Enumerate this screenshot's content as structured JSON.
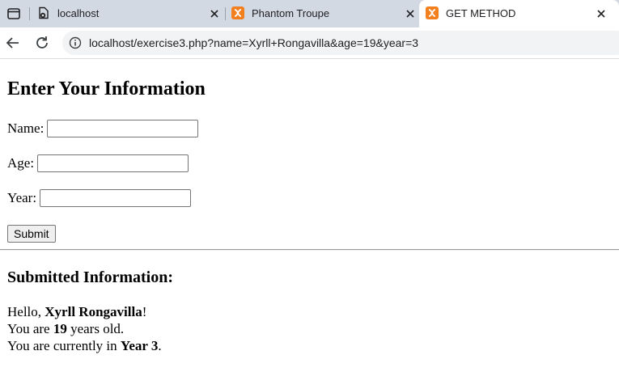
{
  "browser": {
    "tabs": [
      {
        "title": "localhost",
        "active": false
      },
      {
        "title": "Phantom Troupe",
        "active": false
      },
      {
        "title": "GET METHOD",
        "active": true
      }
    ],
    "url": "localhost/exercise3.php?name=Xyrll+Rongavilla&age=19&year=3"
  },
  "form": {
    "title": "Enter Your Information",
    "name_label": "Name:",
    "name_value": "",
    "age_label": "Age:",
    "age_value": "",
    "year_label": "Year:",
    "year_value": "",
    "submit_label": "Submit"
  },
  "result": {
    "title": "Submitted Information:",
    "hello_prefix": "Hello, ",
    "name": "Xyrll Rongavilla",
    "hello_suffix": "!",
    "age_prefix": "You are ",
    "age": "19",
    "age_suffix": " years old.",
    "year_prefix": "You are currently in ",
    "year": "Year 3",
    "year_suffix": "."
  },
  "colors": {
    "tabbar_bg": "#d3d9e3",
    "xampp_orange": "#f47f1f"
  }
}
